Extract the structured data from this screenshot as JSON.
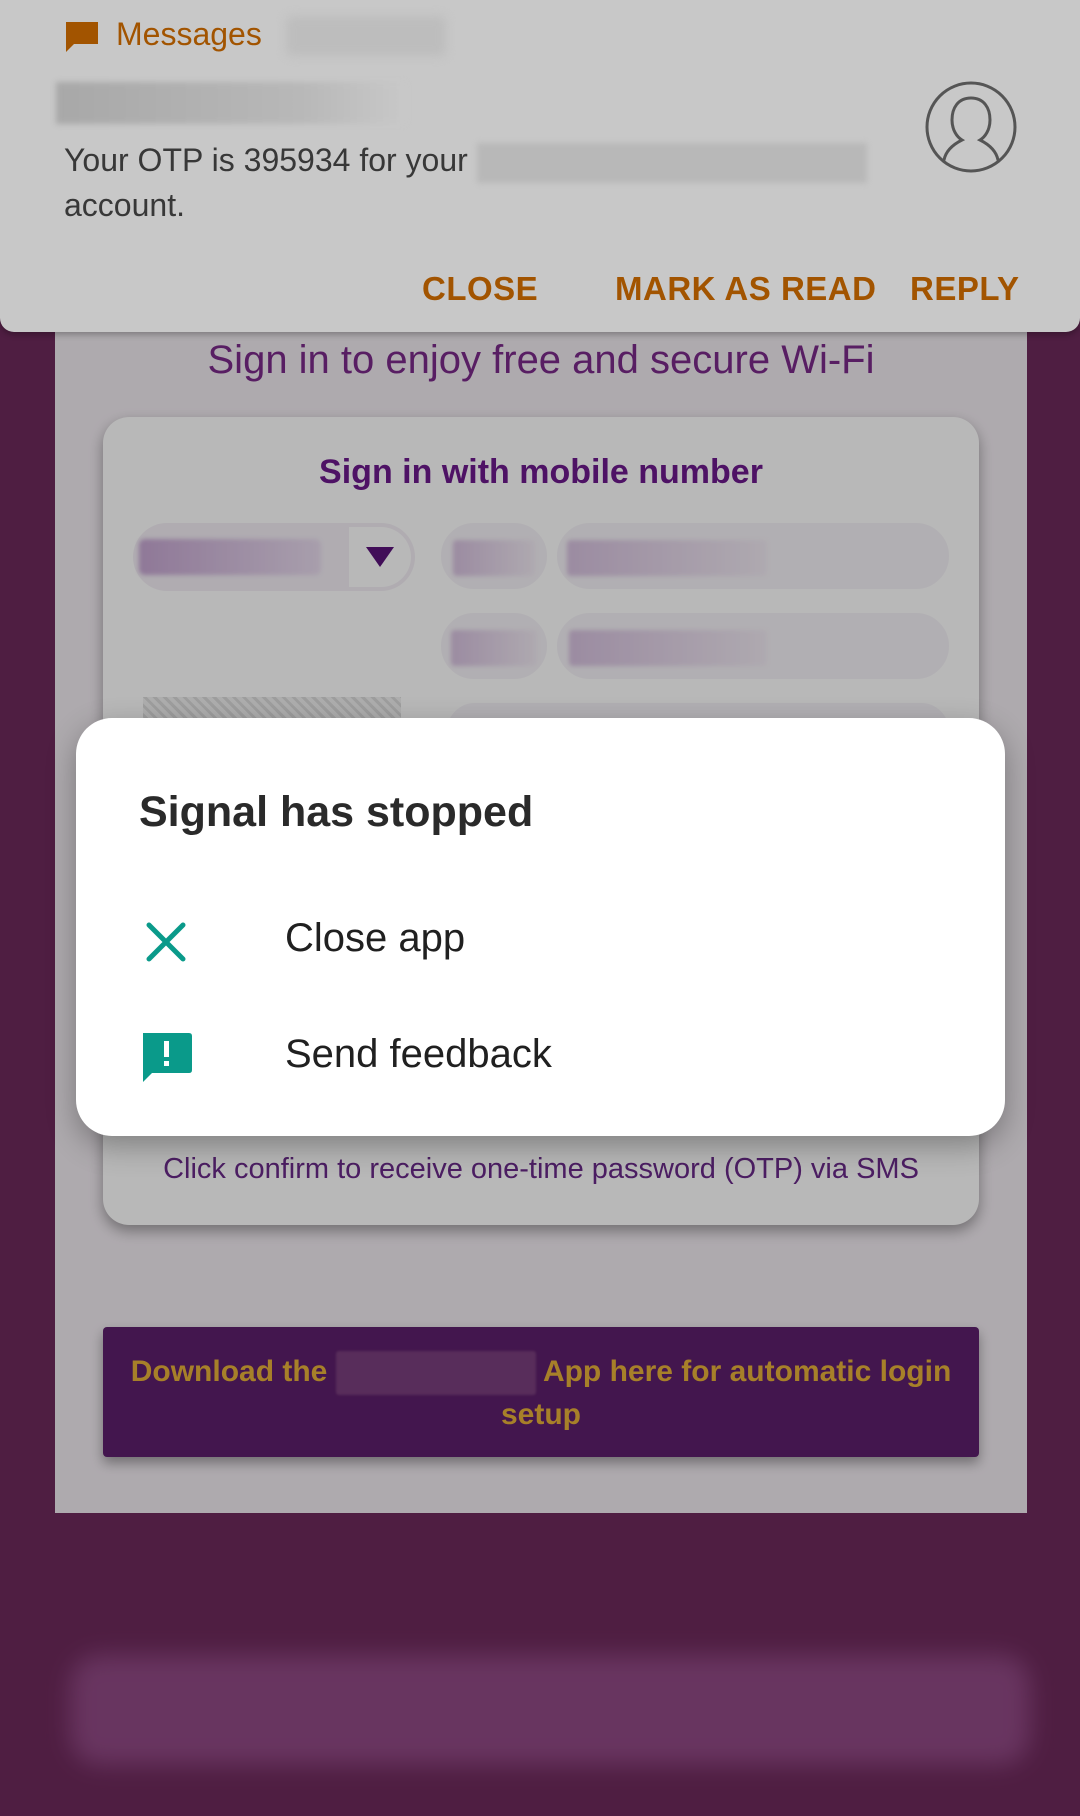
{
  "notification": {
    "app_name": "Messages",
    "body_prefix": "Your OTP is 395934 for your",
    "body_suffix": "account.",
    "actions": {
      "close": "CLOSE",
      "mark_as_read": "MARK AS READ",
      "reply": "REPLY"
    },
    "app_icon": "message-bubble-icon",
    "avatar_icon": "person-avatar-icon",
    "accent_color": "#a25400"
  },
  "portal": {
    "title": "Sign in to enjoy free and secure Wi-Fi",
    "signin_heading": "Sign in with mobile number",
    "otp_hint": "Click confirm to receive one-time password (OTP) via SMS",
    "download_prefix": "Download the",
    "download_suffix": "App here for automatic login setup",
    "dropdown_icon": "triangle-down-icon",
    "background_color": "#6e2a5c",
    "accent_color": "#7a2a8a",
    "banner_color": "#5e1f6c",
    "banner_text_color": "#e8b23a"
  },
  "dialog": {
    "title": "Signal has stopped",
    "options": [
      {
        "label": "Close app",
        "icon": "close-icon"
      },
      {
        "label": "Send feedback",
        "icon": "feedback-icon"
      }
    ],
    "icon_color": "#0a9a8a"
  }
}
